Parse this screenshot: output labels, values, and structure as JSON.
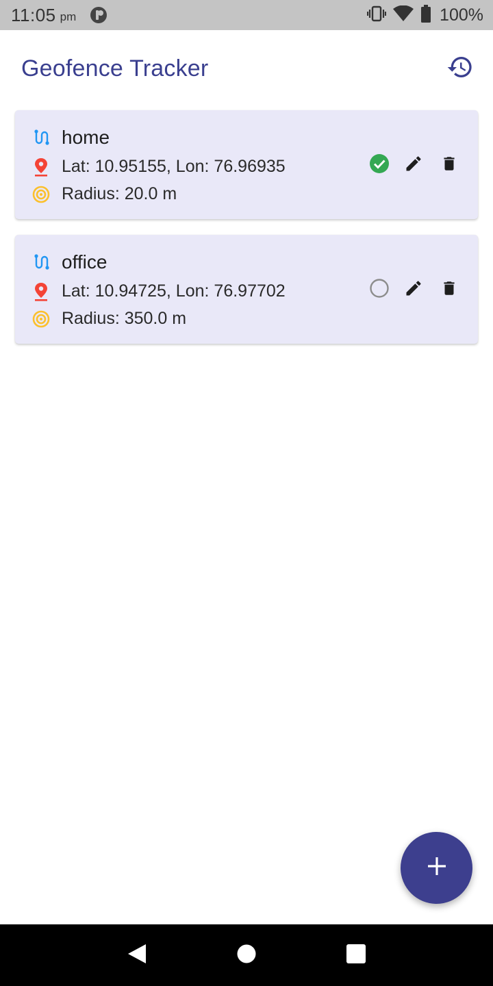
{
  "status_bar": {
    "time": "11:05",
    "ampm": "pm",
    "battery": "100%",
    "icons": [
      "app-notification-icon",
      "vibrate-icon",
      "wifi-icon",
      "battery-icon"
    ]
  },
  "app_bar": {
    "title": "Geofence Tracker",
    "action_icon": "history-icon"
  },
  "geofences": [
    {
      "name": "home",
      "latlon": "Lat: 10.95155, Lon: 76.96935",
      "radius": "Radius: 20.0 m",
      "active": true
    },
    {
      "name": "office",
      "latlon": "Lat: 10.94725, Lon: 76.97702",
      "radius": "Radius: 350.0 m",
      "active": false
    }
  ],
  "fab": {
    "icon": "add-icon"
  },
  "nav": {
    "icons": [
      "back-icon",
      "home-icon",
      "recents-icon"
    ]
  },
  "colors": {
    "primary": "#3d3f8e",
    "title": "#3a3f8f",
    "card_bg": "#e9e8f8",
    "active_check": "#34a853",
    "route_icon": "#2196f3",
    "location_icon": "#f44336",
    "radius_icon": "#fbc02d"
  }
}
